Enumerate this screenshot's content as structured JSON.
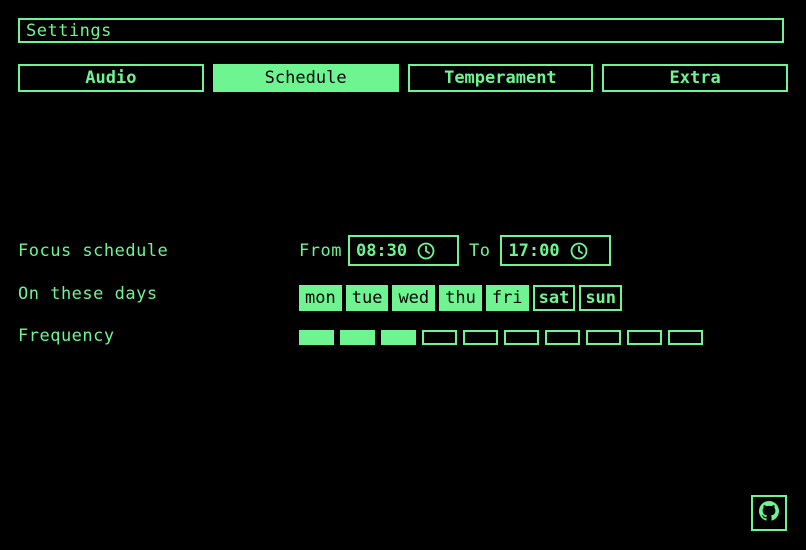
{
  "window": {
    "title": "Settings"
  },
  "tabs": [
    {
      "label": "Audio",
      "active": false
    },
    {
      "label": "Schedule",
      "active": true
    },
    {
      "label": "Temperament",
      "active": false
    },
    {
      "label": "Extra",
      "active": false
    }
  ],
  "schedule": {
    "focus_label": "Focus schedule",
    "from_label": "From",
    "from_value": "08:30",
    "to_label": "To",
    "to_value": "17:00",
    "days_label": "On these days",
    "days": [
      {
        "label": "mon",
        "selected": true
      },
      {
        "label": "tue",
        "selected": true
      },
      {
        "label": "wed",
        "selected": true
      },
      {
        "label": "thu",
        "selected": true
      },
      {
        "label": "fri",
        "selected": true
      },
      {
        "label": "sat",
        "selected": false
      },
      {
        "label": "sun",
        "selected": false
      }
    ],
    "frequency_label": "Frequency",
    "frequency": {
      "level": 3,
      "max": 10
    }
  },
  "footer": {
    "icon": "github-icon"
  },
  "colors": {
    "accent": "#6ef592",
    "background": "#000000"
  }
}
